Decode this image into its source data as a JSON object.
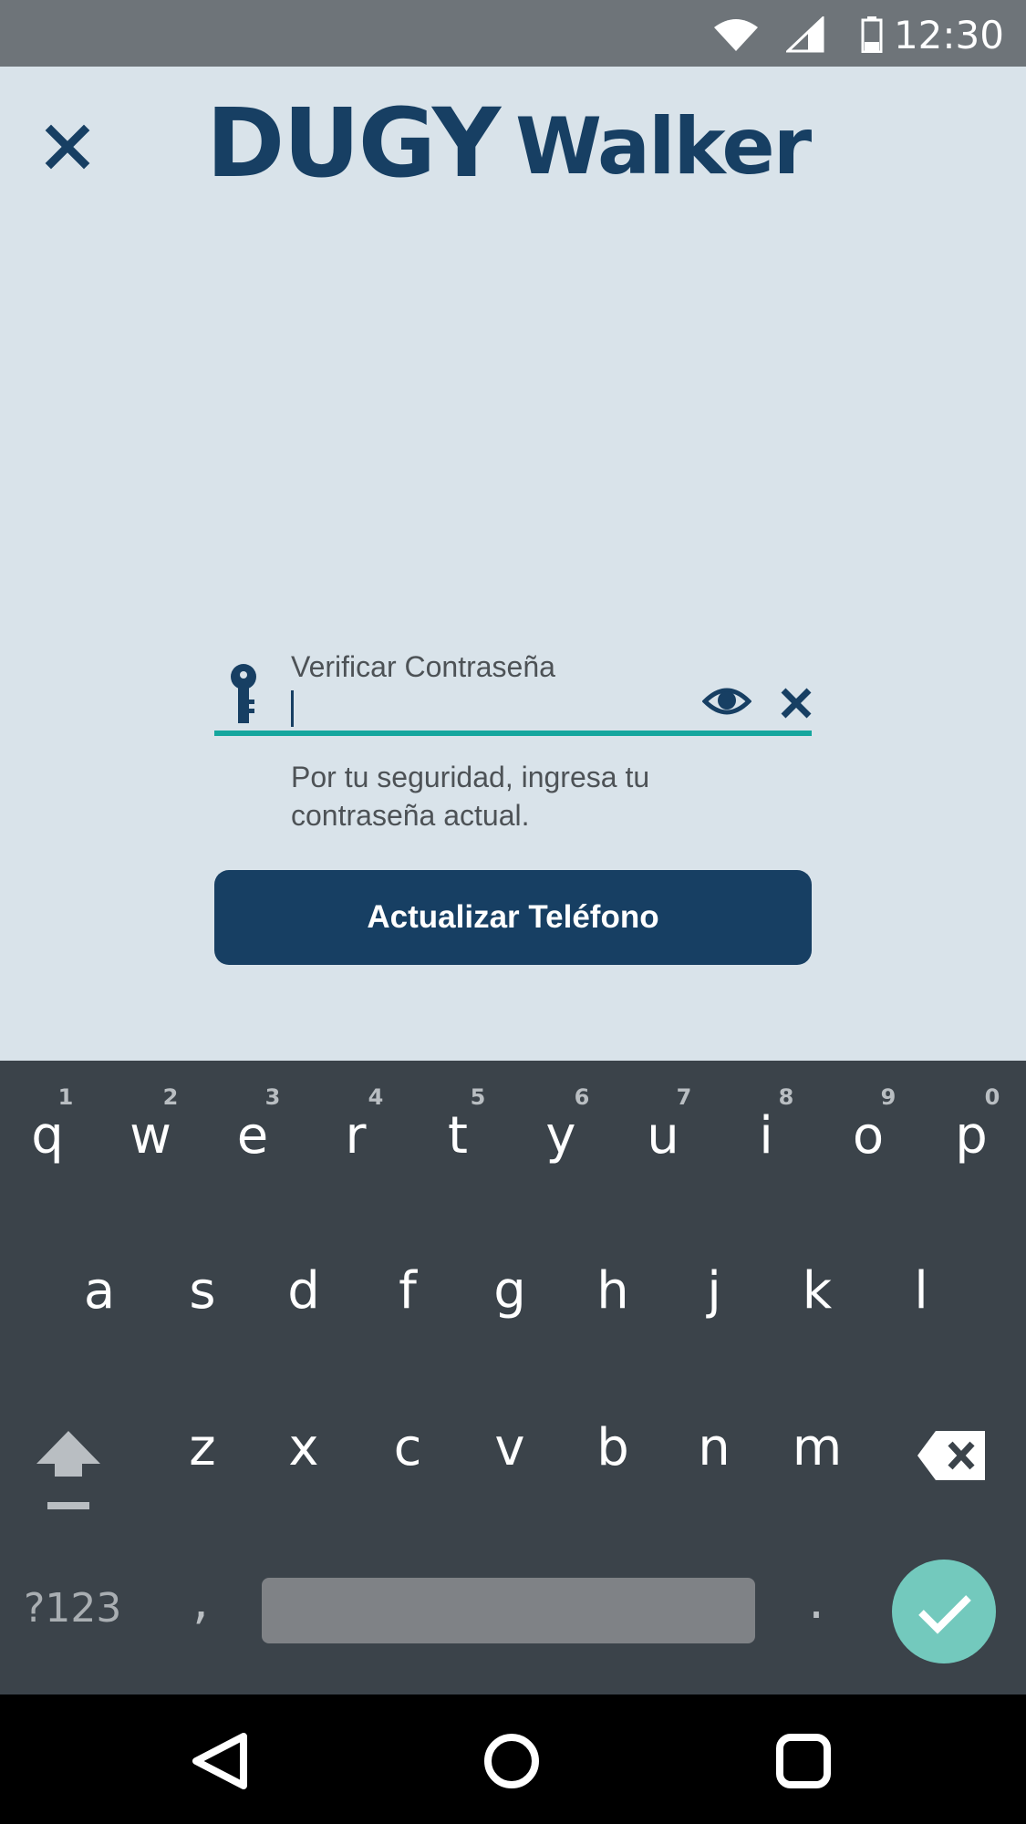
{
  "status_bar": {
    "time": "12:30"
  },
  "header": {
    "logo_primary": "DUGY",
    "logo_secondary": "Walker",
    "close_icon": "close-icon"
  },
  "form": {
    "password_label": "Verificar Contraseña",
    "password_value": "",
    "helper_text": "Por tu seguridad, ingresa tu contraseña actual.",
    "submit_label": "Actualizar Teléfono",
    "icons": [
      "key-icon",
      "eye-icon",
      "clear-icon"
    ]
  },
  "colors": {
    "brand": "#173f63",
    "accent": "#15a69e",
    "background": "#d9e3ea",
    "keyboard": "#3b434a",
    "done_button": "#73c9bd"
  },
  "keyboard": {
    "row1": [
      "q",
      "w",
      "e",
      "r",
      "t",
      "y",
      "u",
      "i",
      "o",
      "p"
    ],
    "row1_hints": [
      "1",
      "2",
      "3",
      "4",
      "5",
      "6",
      "7",
      "8",
      "9",
      "0"
    ],
    "row2": [
      "a",
      "s",
      "d",
      "f",
      "g",
      "h",
      "j",
      "k",
      "l"
    ],
    "row3": [
      "z",
      "x",
      "c",
      "v",
      "b",
      "n",
      "m"
    ],
    "symbols_label": "?123",
    "comma": ",",
    "period": "."
  }
}
